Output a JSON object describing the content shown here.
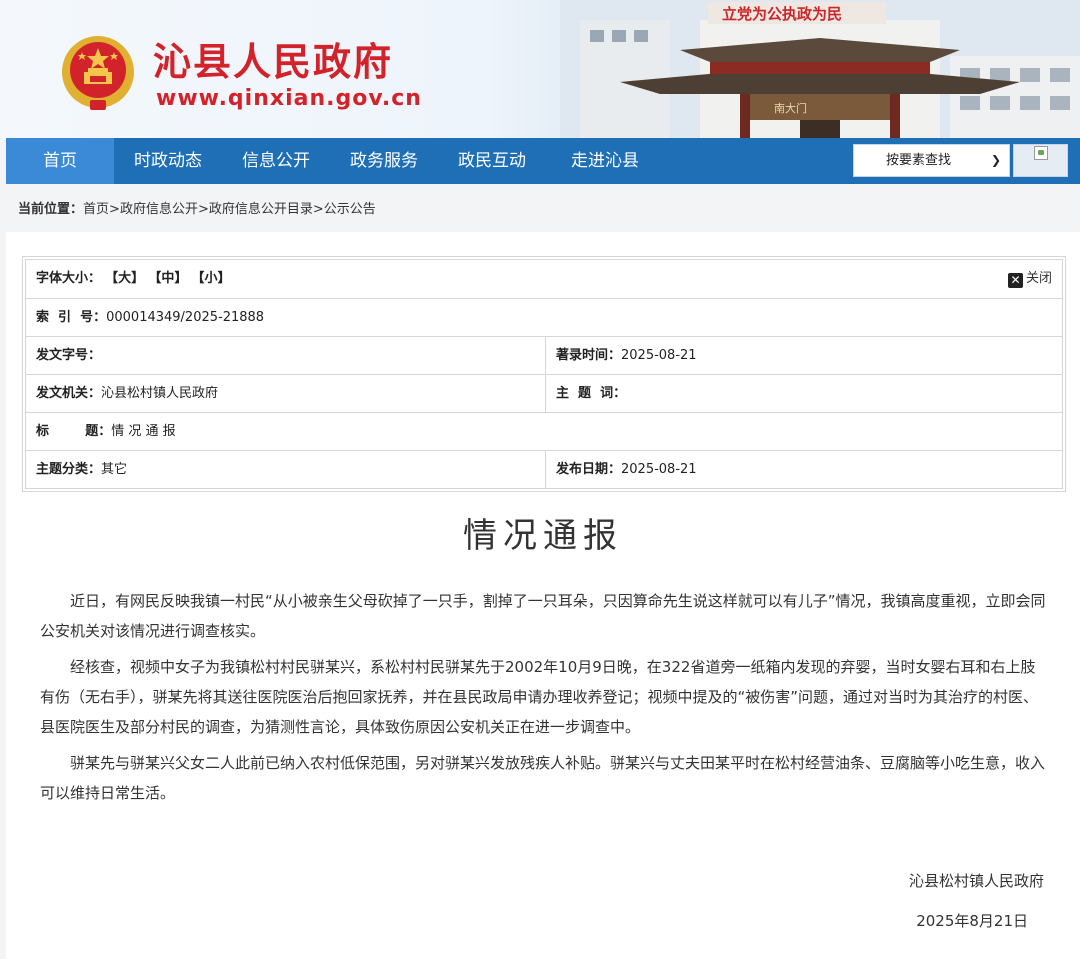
{
  "header": {
    "site_title": "沁县人民政府",
    "site_url": "www.qinxian.gov.cn",
    "banner_sign": "立党为公执政为民",
    "gate_plaque": "南大门"
  },
  "nav": {
    "items": [
      "首页",
      "时政动态",
      "信息公开",
      "政务服务",
      "政民互动",
      "走进沁县"
    ],
    "active_index": 0,
    "search_select": "按要素查找"
  },
  "breadcrumb": {
    "label": "当前位置：",
    "items": [
      "首页",
      "政府信息公开",
      "政府信息公开目录",
      "公示公告"
    ],
    "separator": ">"
  },
  "info": {
    "font_size_label": "字体大小：",
    "font_sizes": [
      "【大】",
      "【中】",
      "【小】"
    ],
    "close_label": "关闭",
    "index_label": "索  引  号：",
    "index_value": "000014349/2025-21888",
    "doc_no_label": "发文字号：",
    "doc_no_value": "",
    "record_time_label": "著录时间：",
    "record_time_value": "2025-08-21",
    "issuer_label": "发文机关：",
    "issuer_value": "沁县松村镇人民政府",
    "keywords_label": "主  题  词：",
    "keywords_value": "",
    "title_label": "标        题：",
    "title_value": "情 况 通 报",
    "category_label": "主题分类：",
    "category_value": "其它",
    "publish_date_label": "发布日期：",
    "publish_date_value": "2025-08-21"
  },
  "doc": {
    "title": "情况通报",
    "paragraphs": [
      "近日，有网民反映我镇一村民“从小被亲生父母砍掉了一只手，割掉了一只耳朵，只因算命先生说这样就可以有儿子”情况，我镇高度重视，立即会同公安机关对该情况进行调查核实。",
      "经核查，视频中女子为我镇松村村民骈某兴，系松村村民骈某先于2002年10月9日晚，在322省道旁一纸箱内发现的弃婴，当时女婴右耳和右上肢有伤（无右手），骈某先将其送往医院医治后抱回家抚养，并在县民政局申请办理收养登记；视频中提及的“被伤害”问题，通过对当时为其治疗的村医、县医院医生及部分村民的调查，为猜测性言论，具体致伤原因公安机关正在进一步调查中。",
      "骈某先与骈某兴父女二人此前已纳入农村低保范围，另对骈某兴发放残疾人补贴。骈某兴与丈夫田某平时在松村经营油条、豆腐脑等小吃生意，收入可以维持日常生活。"
    ],
    "sign_org": "沁县松村镇人民政府",
    "sign_date": "2025年8月21日"
  }
}
